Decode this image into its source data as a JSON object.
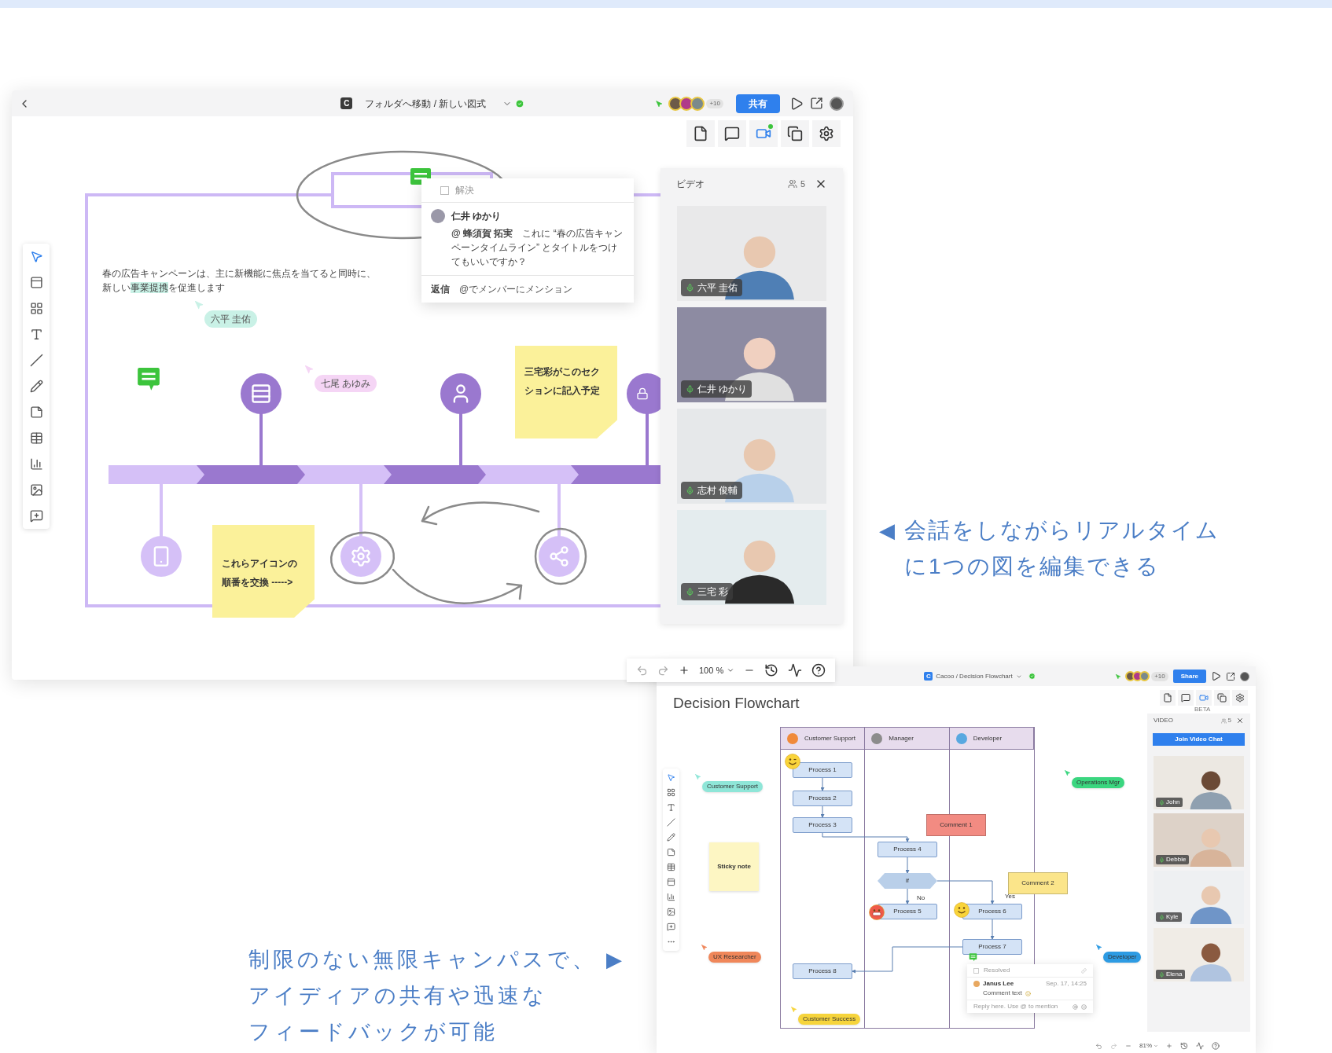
{
  "main_window": {
    "logo": "C",
    "breadcrumb": "フォルダへ移動 / 新しい図式",
    "avatar_overflow": "+10",
    "share_button": "共有",
    "canvas": {
      "paragraph": {
        "line_1": "春の広告キャンペーンは、主に新機能に焦点を当てると同時に、",
        "line_2_start": "新しい",
        "highlight": "事業提携",
        "line_2_end": "を促進します"
      },
      "cursors": [
        {
          "name": "六平 圭佑",
          "color": "#c9f1e6"
        },
        {
          "name": "七尾 あゆみ",
          "color": "#f5d5f5"
        }
      ],
      "sticky_notes": [
        {
          "text": "三宅彩がこのセクションに記入予定"
        },
        {
          "text": "これらアイコンの順番を交換 ----->"
        }
      ],
      "comment": {
        "resolve_label": "解決",
        "resolved": false,
        "author": "仁井 ゆかり",
        "body": "**@ 蜂須賀 拓実**　これに “春の広告キャンペーンタイムライン” とタイトルをつけてもいいですか？",
        "reply_label": "返信",
        "reply_placeholder": "@でメンバーにメンション"
      }
    },
    "video_panel": {
      "title": "ビデオ",
      "participant_count": "5",
      "participants": [
        {
          "name": "六平 圭佑"
        },
        {
          "name": "仁井 ゆかり"
        },
        {
          "name": "志村 俊輔"
        },
        {
          "name": "三宅 彩"
        }
      ]
    },
    "zoom_level": "100 %"
  },
  "second_window": {
    "logo": "C",
    "breadcrumb": "Cacoo / Decision Flowchart",
    "avatar_overflow": "+10",
    "share_button": "Share",
    "title": "Decision Flowchart",
    "video_beta_label": "BETA",
    "lanes": [
      {
        "name": "Customer Support"
      },
      {
        "name": "Manager"
      },
      {
        "name": "Developer"
      }
    ],
    "nodes": [
      {
        "kind": "process",
        "label": "Process 1"
      },
      {
        "kind": "process",
        "label": "Process 2"
      },
      {
        "kind": "process",
        "label": "Process 3"
      },
      {
        "kind": "comment",
        "label": "Comment 1",
        "color": "#f28b82"
      },
      {
        "kind": "process",
        "label": "Process 4"
      },
      {
        "kind": "decision",
        "label": "if"
      },
      {
        "kind": "comment",
        "label": "Comment 2",
        "color": "#fbe58a"
      },
      {
        "kind": "process",
        "label": "Process 5"
      },
      {
        "kind": "process",
        "label": "Process 6"
      },
      {
        "kind": "process",
        "label": "Process 7"
      },
      {
        "kind": "process",
        "label": "Process 8"
      }
    ],
    "edge_labels": [
      {
        "label": "No"
      },
      {
        "label": "Yes"
      }
    ],
    "sticky_note": "Sticky note",
    "cursors": [
      {
        "name": "Customer Support",
        "color": "#8fe6d8"
      },
      {
        "name": "Operations Mgr",
        "color": "#3ad67f"
      },
      {
        "name": "UX Researcher",
        "color": "#f0875a"
      },
      {
        "name": "Developer",
        "color": "#2d9be3"
      },
      {
        "name": "Customer Success",
        "color": "#f6d43c"
      }
    ],
    "comment": {
      "resolve_label": "Resolved",
      "resolved": false,
      "author": "Janus Lee",
      "time": "Sep. 17, 14:25",
      "text": "Comment text",
      "reply_placeholder": "Reply here. Use @ to mention"
    },
    "video_panel": {
      "title": "VIDEO",
      "participant_count": "5",
      "join_button": "Join Video Chat",
      "participants": [
        {
          "name": "John"
        },
        {
          "name": "Debbie"
        },
        {
          "name": "Kyle"
        },
        {
          "name": "Elena"
        }
      ]
    },
    "zoom_level": "81%"
  },
  "captions": [
    {
      "pointer": "◀",
      "lines": [
        "会話をしながらリアルタイム",
        "に1つの図を編集できる"
      ]
    },
    {
      "pointer": "▶",
      "lines": [
        "制限のない無限キャンパスで、",
        "アイディアの共有や迅速な",
        "フィードバックが可能"
      ]
    }
  ]
}
